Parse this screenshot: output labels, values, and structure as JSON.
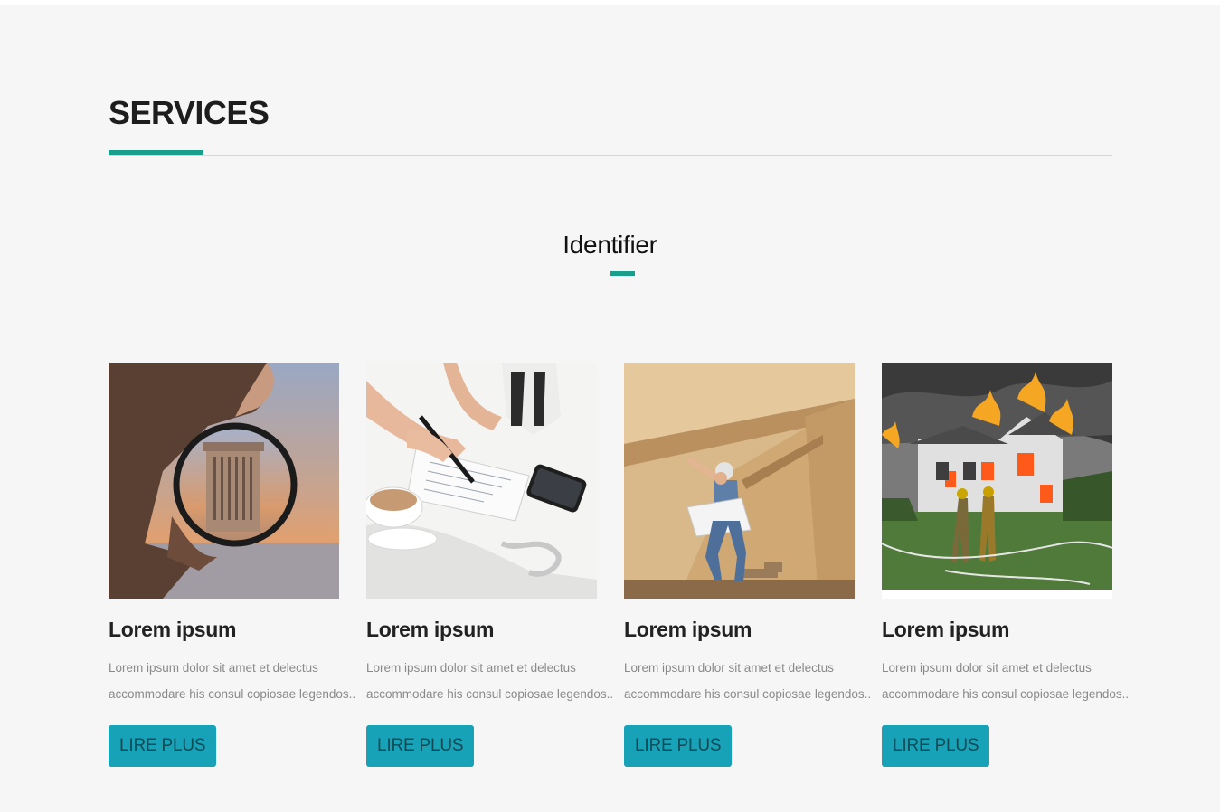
{
  "section": {
    "title": "SERVICES"
  },
  "subsection": {
    "title": "Identifier"
  },
  "cards": [
    {
      "title": "Lorem ipsum",
      "line1": "Lorem ipsum dolor sit amet et delectus",
      "line2": "accommodare his consul copiosae legendos..",
      "button": "LIRE PLUS",
      "image": "magnifying-glass-tower-image"
    },
    {
      "title": "Lorem ipsum",
      "line1": "Lorem ipsum dolor sit amet et delectus",
      "line2": "accommodare his consul copiosae legendos..",
      "button": "LIRE PLUS",
      "image": "writing-notebook-coffee-image"
    },
    {
      "title": "Lorem ipsum",
      "line1": "Lorem ipsum dolor sit amet et delectus",
      "line2": "accommodare his consul copiosae legendos..",
      "button": "LIRE PLUS",
      "image": "worker-attic-blueprint-image"
    },
    {
      "title": "Lorem ipsum",
      "line1": "Lorem ipsum dolor sit amet et delectus",
      "line2": "accommodare his consul copiosae legendos..",
      "button": "LIRE PLUS",
      "image": "house-fire-firefighters-image"
    }
  ],
  "colors": {
    "accent": "#1a9e8c",
    "button": "#17a2b8",
    "background": "#f6f6f6"
  }
}
